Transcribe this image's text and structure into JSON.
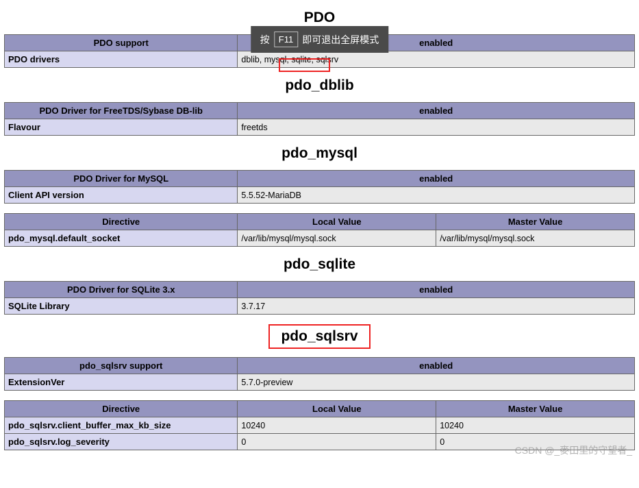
{
  "hint": {
    "pre": "按",
    "key": "F11",
    "post": "即可退出全屏模式"
  },
  "watermark": "CSDN @_麥田里的守望者_",
  "sections": {
    "pdo": {
      "title": "PDO",
      "h_support": "PDO support",
      "v_support": "enabled",
      "r_drivers_k": "PDO drivers",
      "r_drivers_v": "dblib, mysql, sqlite, sqlsrv"
    },
    "dblib": {
      "title": "pdo_dblib",
      "h_driver": "PDO Driver for FreeTDS/Sybase DB-lib",
      "v_driver": "enabled",
      "r_flavour_k": "Flavour",
      "r_flavour_v": "freetds"
    },
    "mysql": {
      "title": "pdo_mysql",
      "h_driver": "PDO Driver for MySQL",
      "v_driver": "enabled",
      "r_api_k": "Client API version",
      "r_api_v": "5.5.52-MariaDB",
      "h_directive": "Directive",
      "h_local": "Local Value",
      "h_master": "Master Value",
      "r_sock_k": "pdo_mysql.default_socket",
      "r_sock_l": "/var/lib/mysql/mysql.sock",
      "r_sock_m": "/var/lib/mysql/mysql.sock"
    },
    "sqlite": {
      "title": "pdo_sqlite",
      "h_driver": "PDO Driver for SQLite 3.x",
      "v_driver": "enabled",
      "r_lib_k": "SQLite Library",
      "r_lib_v": "3.7.17"
    },
    "sqlsrv": {
      "title": "pdo_sqlsrv",
      "h_support": "pdo_sqlsrv support",
      "v_support": "enabled",
      "r_ext_k": "ExtensionVer",
      "r_ext_v": "5.7.0-preview",
      "h_directive": "Directive",
      "h_local": "Local Value",
      "h_master": "Master Value",
      "r_buf_k": "pdo_sqlsrv.client_buffer_max_kb_size",
      "r_buf_l": "10240",
      "r_buf_m": "10240",
      "r_log_k": "pdo_sqlsrv.log_severity",
      "r_log_l": "0",
      "r_log_m": "0"
    }
  }
}
